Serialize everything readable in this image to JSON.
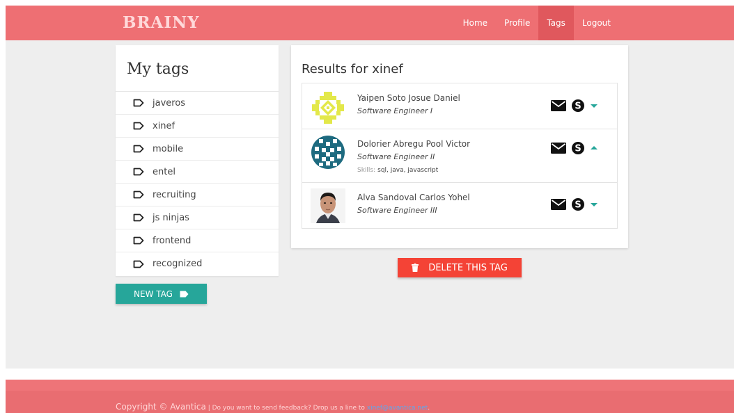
{
  "nav": {
    "brand": "BRAINY",
    "links": [
      "Home",
      "Profile",
      "Tags",
      "Logout"
    ],
    "active": "Tags"
  },
  "tags": {
    "title": "My tags",
    "items": [
      "javeros",
      "xinef",
      "mobile",
      "entel",
      "recruiting",
      "js ninjas",
      "frontend",
      "recognized"
    ],
    "new_tag_label": "NEW TAG"
  },
  "results": {
    "title": "Results for xinef",
    "people": [
      {
        "name": "Yaipen Soto Josue Daniel",
        "title": "Software Engineer I",
        "expanded": false
      },
      {
        "name": "Dolorier Abregu Pool Victor",
        "title": "Software Engineer II",
        "skills_label": "Skills:",
        "skills": "sql, java, javascript",
        "expanded": true
      },
      {
        "name": "Alva Sandoval Carlos Yohel",
        "title": "Software Engineer III",
        "expanded": false
      }
    ],
    "delete_label": "DELETE THIS TAG"
  },
  "footer": {
    "copyright": "Copyright © Avantica",
    "separator": " | ",
    "feedback": "Do you want to send feedback? Drop us a line to ",
    "email": "xinef@avantica.net",
    "end": "."
  },
  "colors": {
    "nav": "#ee6f73",
    "teal": "#26a69a",
    "danger": "#f44336"
  }
}
